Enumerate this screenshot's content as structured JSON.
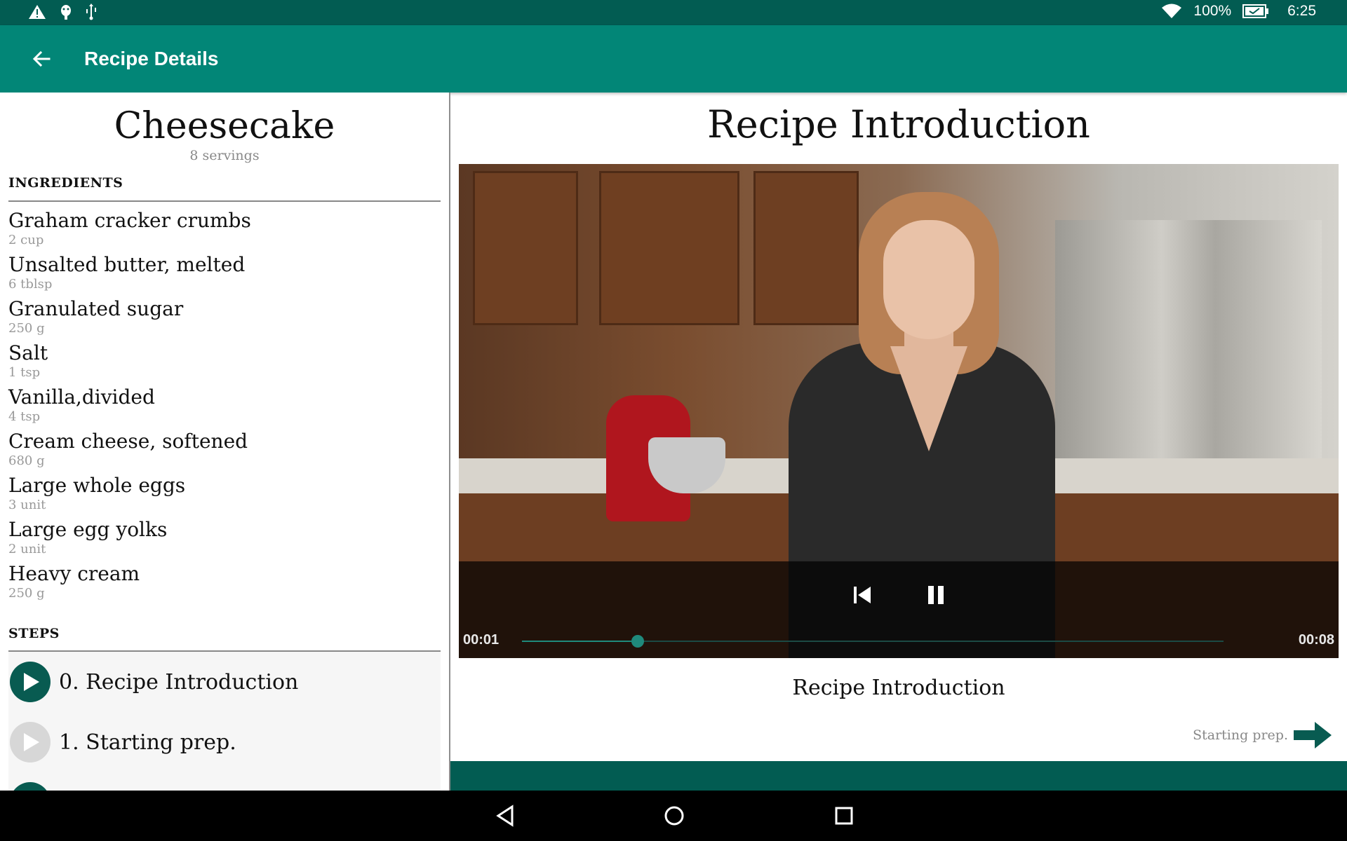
{
  "status_bar": {
    "icons_left": [
      "warning-icon",
      "android-debug-icon",
      "usb-icon"
    ],
    "icons_right": [
      "wifi-icon",
      "battery-icon"
    ],
    "battery": "100%",
    "time": "6:25"
  },
  "app_bar": {
    "title": "Recipe Details",
    "back_icon": "arrow-back-icon"
  },
  "recipe": {
    "name": "Cheesecake",
    "servings": "8 servings",
    "ingredients_heading": "INGREDIENTS",
    "ingredients": [
      {
        "name": "Graham cracker crumbs",
        "qty": "2 cup"
      },
      {
        "name": "Unsalted butter, melted",
        "qty": "6 tblsp"
      },
      {
        "name": "Granulated sugar",
        "qty": "250 g"
      },
      {
        "name": "Salt",
        "qty": "1 tsp"
      },
      {
        "name": "Vanilla,divided",
        "qty": "4 tsp"
      },
      {
        "name": "Cream cheese, softened",
        "qty": "680 g"
      },
      {
        "name": "Large whole eggs",
        "qty": "3 unit"
      },
      {
        "name": "Large egg yolks",
        "qty": "2 unit"
      },
      {
        "name": "Heavy cream",
        "qty": "250 g"
      }
    ],
    "steps_heading": "STEPS",
    "steps": [
      {
        "label": "0. Recipe Introduction",
        "active": true
      },
      {
        "label": "1. Starting prep.",
        "active": false
      }
    ]
  },
  "detail": {
    "title": "Recipe Introduction",
    "description": "Recipe Introduction",
    "next_label": "Starting prep.",
    "next_icon": "arrow-forward-icon"
  },
  "player": {
    "current_time": "00:01",
    "duration": "00:08",
    "progress_fraction": 0.165,
    "prev_icon": "skip-previous-icon",
    "pause_icon": "pause-icon"
  },
  "nav_bar": {
    "icons": [
      "back-triangle-icon",
      "home-circle-icon",
      "recents-square-icon"
    ]
  },
  "colors": {
    "status_bar": "#025c52",
    "app_bar": "#028677",
    "accent_dark": "#085b51"
  }
}
